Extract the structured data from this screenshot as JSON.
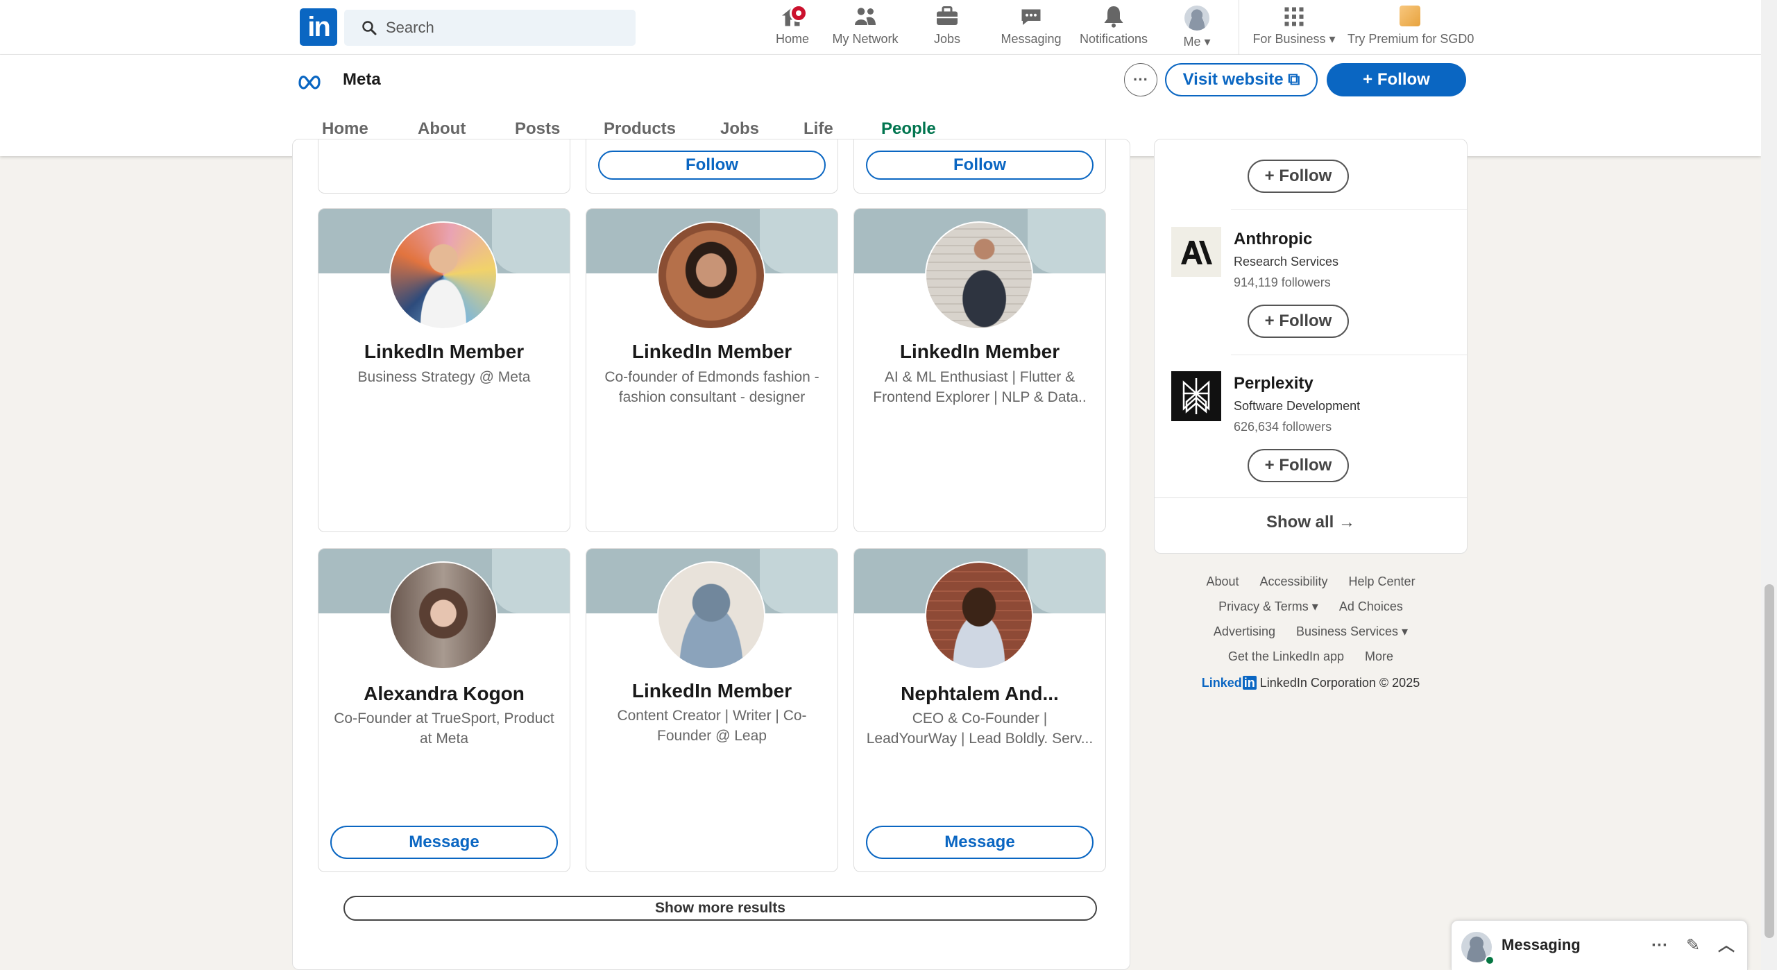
{
  "nav": {
    "logo": "in",
    "search_placeholder": "Search",
    "items": [
      {
        "label": "Home"
      },
      {
        "label": "My Network"
      },
      {
        "label": "Jobs"
      },
      {
        "label": "Messaging"
      },
      {
        "label": "Notifications"
      },
      {
        "label": "Me"
      },
      {
        "label": "For Business"
      },
      {
        "label": "Try Premium for SGD0"
      }
    ]
  },
  "company": {
    "name": "Meta",
    "more": "···",
    "visit_website": "Visit website",
    "follow": "+ Follow",
    "tabs": [
      "Home",
      "About",
      "Posts",
      "Products",
      "Jobs",
      "Life",
      "People"
    ],
    "active_tab": "People"
  },
  "partial_follow": [
    "Follow",
    "Follow"
  ],
  "people": [
    {
      "name": "LinkedIn Member",
      "headline": "Business Strategy @ Meta",
      "button": ""
    },
    {
      "name": "LinkedIn Member",
      "headline": "Co-founder of Edmonds fashion - fashion consultant - designer",
      "button": ""
    },
    {
      "name": "LinkedIn Member",
      "headline": "AI & ML Enthusiast | Flutter & Frontend Explorer | NLP & Data..",
      "button": ""
    },
    {
      "name": "Alexandra Kogon",
      "headline": "Co-Founder at TrueSport, Product at Meta",
      "button": "Message"
    },
    {
      "name": "LinkedIn Member",
      "headline": "Content Creator | Writer | Co-Founder @ Leap",
      "button": ""
    },
    {
      "name": "Nephtalem And...",
      "headline": "CEO & Co-Founder | LeadYourWay | Lead Boldly. Serv...",
      "button": "Message"
    }
  ],
  "show_more": "Show more results",
  "suggestions": {
    "top_follow": "+ Follow",
    "items": [
      {
        "name": "Anthropic",
        "industry": "Research Services",
        "followers": "914,119 followers",
        "button": "+ Follow"
      },
      {
        "name": "Perplexity",
        "industry": "Software Development",
        "followers": "626,634 followers",
        "button": "+ Follow"
      }
    ],
    "show_all": "Show all →"
  },
  "footer": {
    "row1": [
      "About",
      "Accessibility",
      "Help Center"
    ],
    "row2": [
      "Privacy & Terms ▾",
      "Ad Choices"
    ],
    "row3": [
      "Advertising",
      "Business Services ▾"
    ],
    "row4": [
      "Get the LinkedIn app",
      "More"
    ],
    "brand": "Linked",
    "brand_in": "in",
    "copyright": "LinkedIn Corporation © 2025"
  },
  "messaging": {
    "label": "Messaging"
  },
  "colors": {
    "brand": "#0a66c2",
    "active_tab": "#01754f",
    "notification": "#cb112d"
  }
}
